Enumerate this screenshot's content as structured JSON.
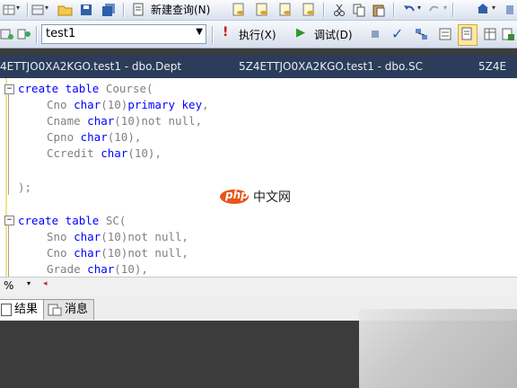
{
  "toolbar1": {
    "new_query_label": "新建查询(N)"
  },
  "toolbar2": {
    "database_value": "test1",
    "execute_label": "执行(X)",
    "debug_label": "调试(D)"
  },
  "tabs": [
    {
      "label": "4ETTJO0XA2KGO.test1 - dbo.Dept"
    },
    {
      "label": "5Z4ETTJO0XA2KGO.test1 - dbo.SC"
    },
    {
      "label": "5Z4E"
    }
  ],
  "code": {
    "l1_kw": "create table",
    "l1_rest": " Course(",
    "l2_col": "Cno",
    "l2_type": " char",
    "l2_rest": "(10)",
    "l2_kw": "primary key",
    "l2_end": ",",
    "l3_col": "Cname",
    "l3_type": " char",
    "l3_rest": "(10)",
    "l3_kw": "not null",
    "l3_end": ",",
    "l4_col": "Cpno",
    "l4_type": " char",
    "l4_rest": "(10),",
    "l5_col": "Ccredit",
    "l5_type": " char",
    "l5_rest": "(10),",
    "l6": ");",
    "l7_kw": "create table",
    "l7_rest": " SC(",
    "l8_col": "Sno",
    "l8_type": " char",
    "l8_rest": "(10)",
    "l8_kw": "not null",
    "l8_end": ",",
    "l9_col": "Cno",
    "l9_type": " char",
    "l9_rest": "(10)",
    "l9_kw": "not null",
    "l9_end": ",",
    "l10_col": "Grade",
    "l10_type": " char",
    "l10_rest": "(10),"
  },
  "zoom": {
    "value": "%"
  },
  "result_tabs": {
    "results": "结果",
    "messages": "消息"
  },
  "watermark": {
    "logo_text": "php",
    "site_text": "中文网"
  },
  "colors": {
    "tab_bar": "#2b3d5a",
    "keyword": "#0000ff",
    "gray_text": "#808080"
  }
}
